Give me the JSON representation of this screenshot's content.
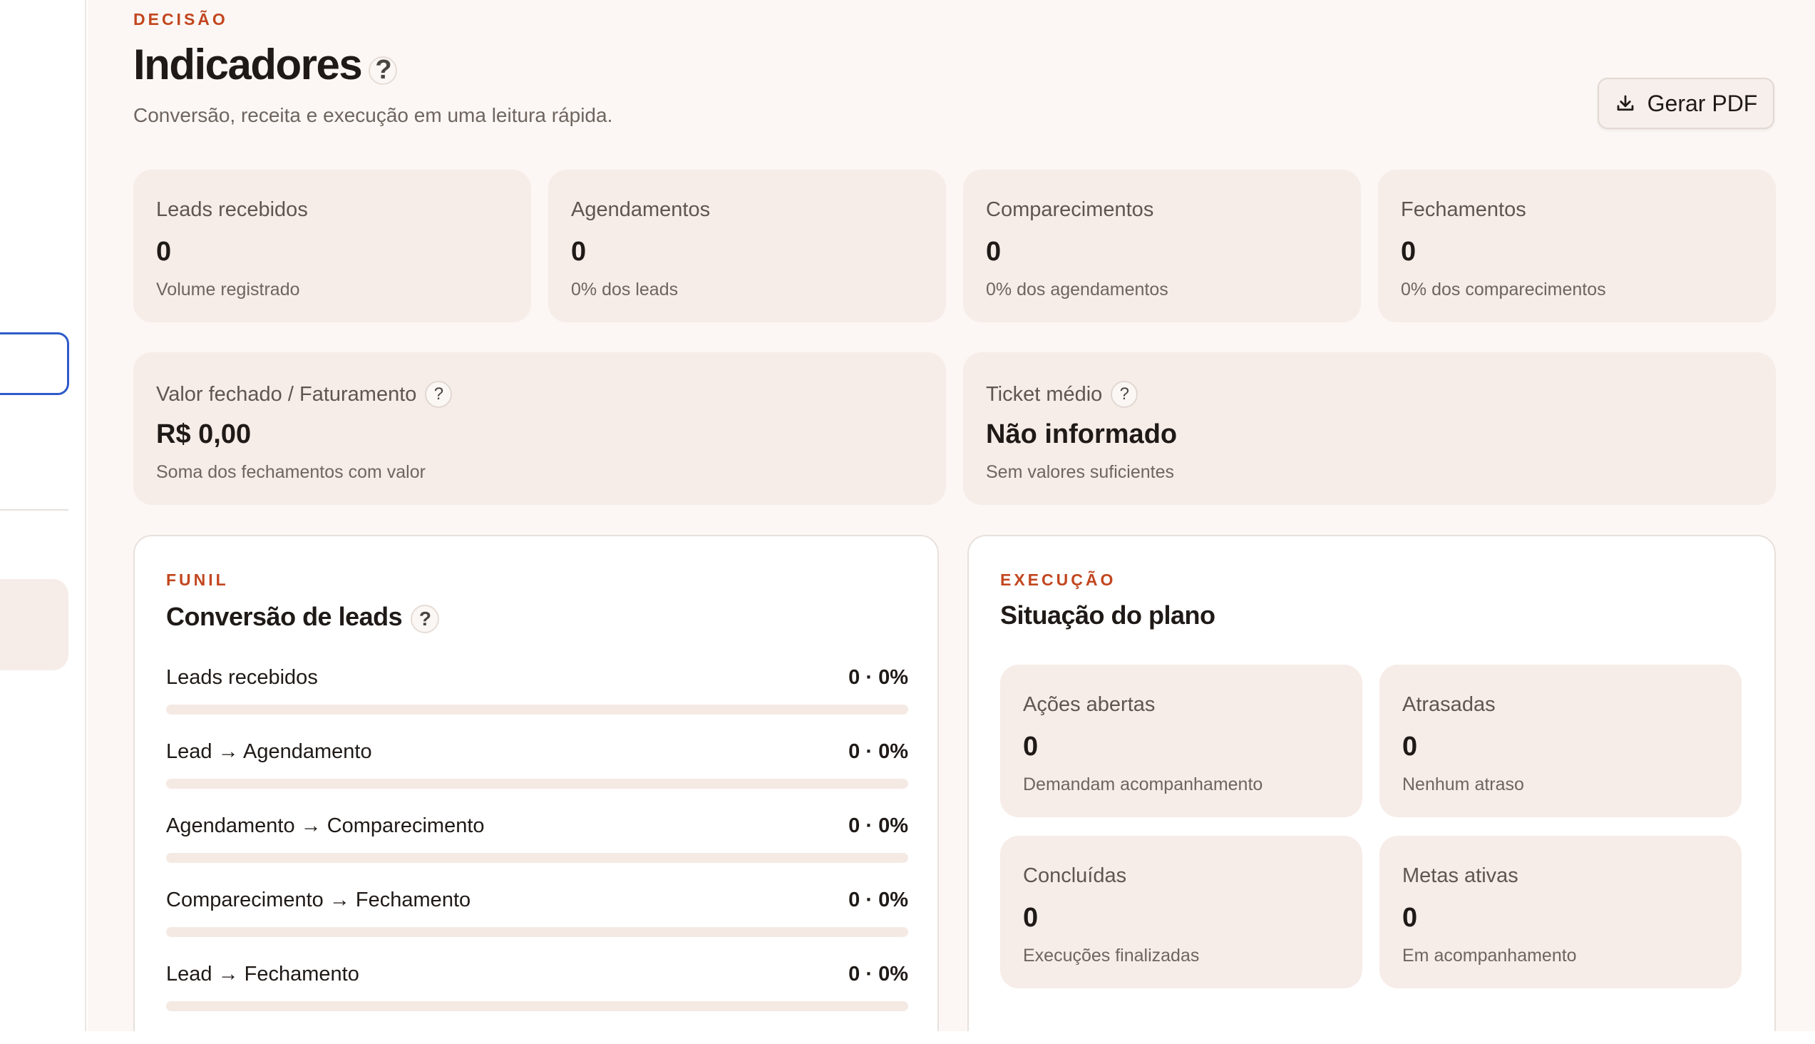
{
  "header": {
    "eyebrow": "DECISÃO",
    "title": "Indicadores",
    "subtitle": "Conversão, receita e execução em uma leitura rápida.",
    "pdf_button": "Gerar PDF"
  },
  "kpis": [
    {
      "label": "Leads recebidos",
      "value": "0",
      "note": "Volume registrado"
    },
    {
      "label": "Agendamentos",
      "value": "0",
      "note": "0% dos leads"
    },
    {
      "label": "Comparecimentos",
      "value": "0",
      "note": "0% dos agendamentos"
    },
    {
      "label": "Fechamentos",
      "value": "0",
      "note": "0% dos comparecimentos"
    }
  ],
  "revenue": {
    "label": "Valor fechado / Faturamento",
    "value": "R$ 0,00",
    "note": "Soma dos fechamentos com valor"
  },
  "ticket": {
    "label": "Ticket médio",
    "value": "Não informado",
    "note": "Sem valores suficientes"
  },
  "funnel": {
    "eyebrow": "FUNIL",
    "title": "Conversão de leads",
    "rows": [
      {
        "label": "Leads recebidos",
        "value": "0 · 0%",
        "progress": 0
      },
      {
        "label": "Lead → Agendamento",
        "value": "0 · 0%",
        "progress": 0
      },
      {
        "label": "Agendamento → Comparecimento",
        "value": "0 · 0%",
        "progress": 0
      },
      {
        "label": "Comparecimento → Fechamento",
        "value": "0 · 0%",
        "progress": 0
      },
      {
        "label": "Lead → Fechamento",
        "value": "0 · 0%",
        "progress": 0
      }
    ]
  },
  "execution": {
    "eyebrow": "EXECUÇÃO",
    "title": "Situação do plano",
    "cards": [
      {
        "label": "Ações abertas",
        "value": "0",
        "note": "Demandam acompanhamento"
      },
      {
        "label": "Atrasadas",
        "value": "0",
        "note": "Nenhum atraso"
      },
      {
        "label": "Concluídas",
        "value": "0",
        "note": "Execuções finalizadas"
      },
      {
        "label": "Metas ativas",
        "value": "0",
        "note": "Em acompanhamento"
      }
    ]
  },
  "help_glyph": "?",
  "colors": {
    "accent": "#c2461f",
    "card_bg": "#f6ece8",
    "page_bg": "#fcf7f4",
    "selection": "#2f5bc9"
  }
}
